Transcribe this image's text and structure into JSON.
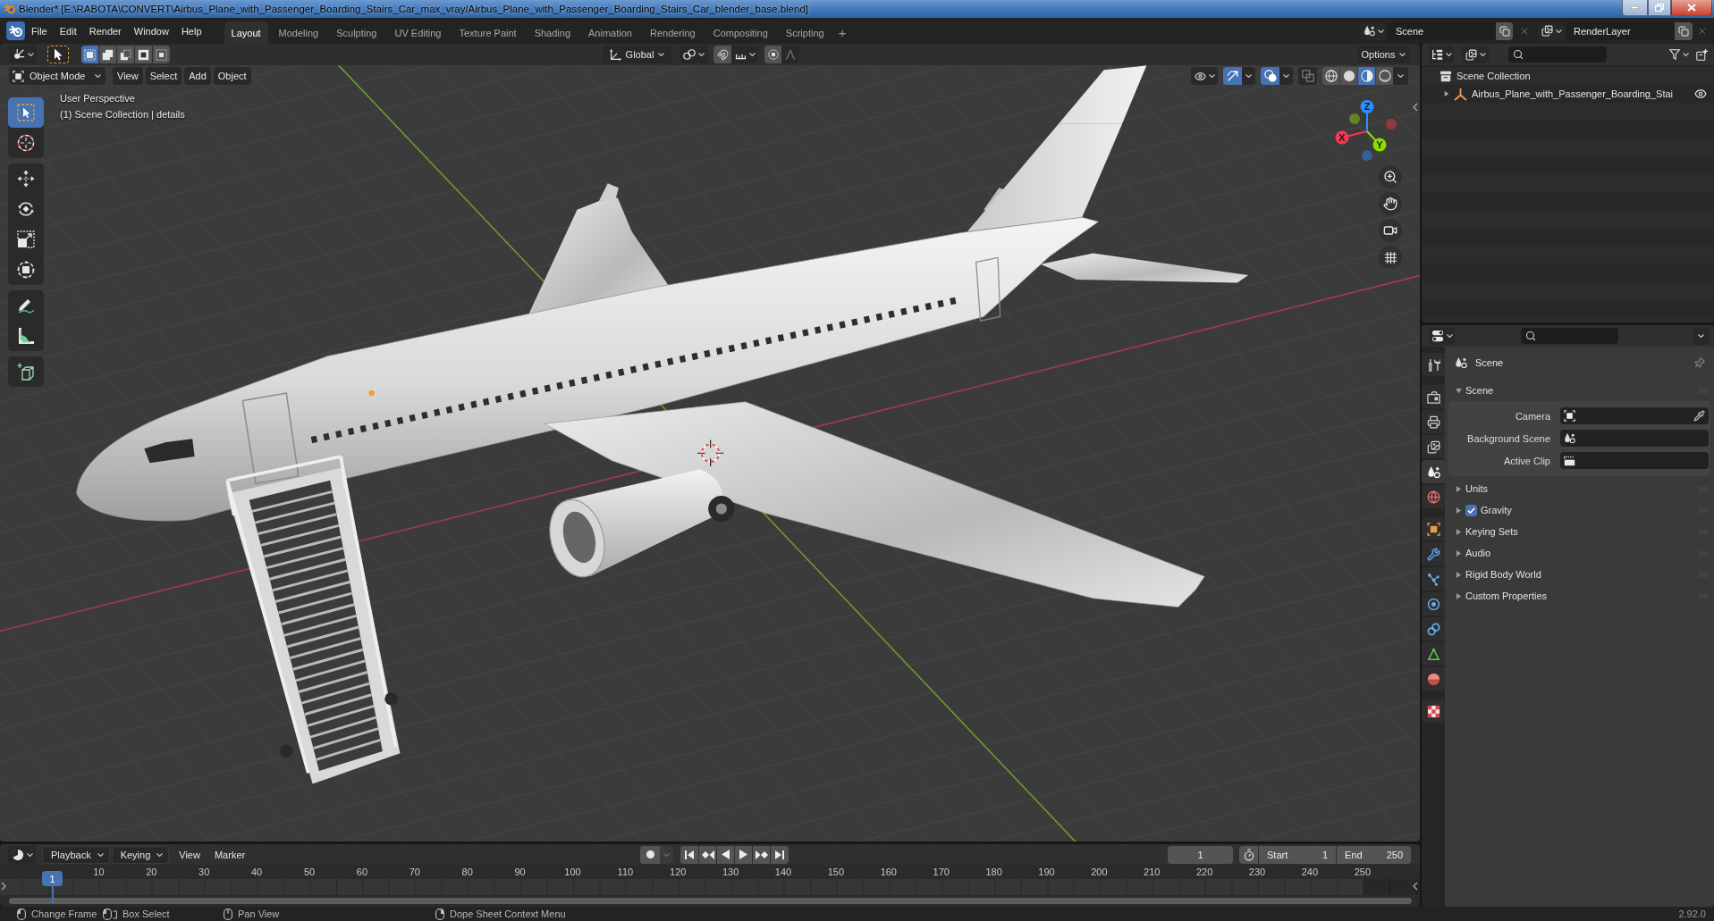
{
  "window": {
    "title": "Blender* [E:\\RABOTA\\CONVERT\\Airbus_Plane_with_Passenger_Boarding_Stairs_Car_max_vray/Airbus_Plane_with_Passenger_Boarding_Stairs_Car_blender_base.blend]"
  },
  "top_bar": {
    "menus": [
      "File",
      "Edit",
      "Render",
      "Window",
      "Help"
    ],
    "workspaces": [
      {
        "label": "Layout",
        "selected": true
      },
      {
        "label": "Modeling",
        "selected": false
      },
      {
        "label": "Sculpting",
        "selected": false
      },
      {
        "label": "UV Editing",
        "selected": false
      },
      {
        "label": "Texture Paint",
        "selected": false
      },
      {
        "label": "Shading",
        "selected": false
      },
      {
        "label": "Animation",
        "selected": false
      },
      {
        "label": "Rendering",
        "selected": false
      },
      {
        "label": "Compositing",
        "selected": false
      },
      {
        "label": "Scripting",
        "selected": false
      }
    ],
    "add_workspace": "+",
    "scene": "Scene",
    "view_layer": "RenderLayer"
  },
  "viewport": {
    "tool_header": {
      "selection_modes": [
        {
          "kind": "set",
          "selected": true
        },
        {
          "kind": "extend",
          "selected": false
        },
        {
          "kind": "subtract",
          "selected": false
        },
        {
          "kind": "invert",
          "selected": false
        },
        {
          "kind": "intersect",
          "selected": false
        }
      ],
      "orientation": "Global",
      "options": "Options"
    },
    "header": {
      "mode": "Object Mode",
      "menus": [
        "View",
        "Select",
        "Add",
        "Object"
      ],
      "toggles": [
        {
          "kind": "gizmos",
          "on": true
        },
        {
          "kind": "overlays",
          "on": true
        },
        {
          "kind": "xray",
          "on": false
        }
      ],
      "shading": [
        {
          "kind": "wireframe",
          "selected": false
        },
        {
          "kind": "solid",
          "selected": false
        },
        {
          "kind": "material",
          "selected": true
        },
        {
          "kind": "rendered",
          "selected": false
        }
      ]
    },
    "info": [
      "User Perspective",
      "(1) Scene Collection | details"
    ],
    "tool_groups": [
      [
        {
          "kind": "select_box",
          "selected": true
        },
        {
          "kind": "cursor",
          "selected": false
        }
      ],
      [
        {
          "kind": "move",
          "selected": false
        },
        {
          "kind": "rotate",
          "selected": false
        },
        {
          "kind": "scale",
          "selected": false
        },
        {
          "kind": "transform",
          "selected": false
        }
      ],
      [
        {
          "kind": "annotate",
          "selected": false
        },
        {
          "kind": "measure",
          "selected": false
        }
      ],
      [
        {
          "kind": "add_cube",
          "selected": false
        }
      ]
    ],
    "gizmo_axes": [
      {
        "label": "X",
        "color": "#ff3352"
      },
      {
        "label": "Y",
        "color": "#8bdc00"
      },
      {
        "label": "Z",
        "color": "#2890ff"
      }
    ]
  },
  "outliner": {
    "root": "Scene Collection",
    "items": [
      {
        "label": "Airbus_Plane_with_Passenger_Boarding_Stai",
        "expanded": false,
        "visible": true
      }
    ]
  },
  "properties": {
    "tab_groups": [
      [
        {
          "kind": "tool",
          "selected": false
        }
      ],
      [
        {
          "kind": "render",
          "selected": false
        },
        {
          "kind": "output",
          "selected": false
        },
        {
          "kind": "view_layer",
          "selected": false
        },
        {
          "kind": "scene",
          "selected": true
        },
        {
          "kind": "world",
          "selected": false
        }
      ],
      [
        {
          "kind": "object",
          "selected": false
        },
        {
          "kind": "modifiers",
          "selected": false
        },
        {
          "kind": "particles",
          "selected": false
        },
        {
          "kind": "physics",
          "selected": false
        },
        {
          "kind": "constraints",
          "selected": false
        },
        {
          "kind": "data",
          "selected": false
        },
        {
          "kind": "material",
          "selected": false
        }
      ],
      [
        {
          "kind": "texture",
          "selected": false
        }
      ]
    ],
    "context": "Scene",
    "panels": [
      {
        "title": "Scene",
        "kind": "plain",
        "expanded": true,
        "fields": [
          {
            "label": "Camera",
            "kind": "object"
          },
          {
            "label": "Background Scene",
            "kind": "scene"
          },
          {
            "label": "Active Clip",
            "kind": "clip"
          }
        ]
      },
      {
        "title": "Units",
        "kind": "plain",
        "expanded": false
      },
      {
        "title": "Gravity",
        "kind": "toggle",
        "expanded": false,
        "checked": true
      },
      {
        "title": "Keying Sets",
        "kind": "plain",
        "expanded": false
      },
      {
        "title": "Audio",
        "kind": "plain",
        "expanded": false
      },
      {
        "title": "Rigid Body World",
        "kind": "plain",
        "expanded": false
      },
      {
        "title": "Custom Properties",
        "kind": "plain",
        "expanded": false
      }
    ]
  },
  "timeline": {
    "menus": [
      {
        "label": "Playback",
        "kind": "dropdown"
      },
      {
        "label": "Keying",
        "kind": "dropdown"
      },
      {
        "label": "View",
        "kind": "menu"
      },
      {
        "label": "Marker",
        "kind": "menu"
      }
    ],
    "current_frame": "1",
    "start": {
      "label": "Start",
      "value": "1"
    },
    "end": {
      "label": "End",
      "value": "250"
    },
    "playhead": "1",
    "ruler": [
      "10",
      "20",
      "30",
      "40",
      "50",
      "60",
      "70",
      "80",
      "90",
      "100",
      "110",
      "120",
      "130",
      "140",
      "150",
      "160",
      "170",
      "180",
      "190",
      "200",
      "210",
      "220",
      "230",
      "240",
      "250"
    ]
  },
  "status_bar": {
    "hints": [
      {
        "kind": "left",
        "label": "Change Frame"
      },
      {
        "kind": "left_drag",
        "label": "Box Select"
      },
      {
        "kind": "middle",
        "label": "Pan View"
      },
      {
        "kind": "right",
        "label": "Dope Sheet Context Menu"
      }
    ],
    "version": "2.92.0"
  }
}
